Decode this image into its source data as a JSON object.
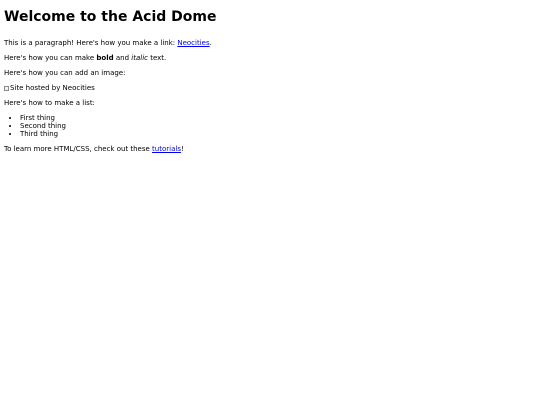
{
  "page": {
    "heading": "Welcome to the Acid Dome",
    "para1": {
      "prefix": "This is a paragraph! Here's how you make a link: ",
      "link": "Neocities",
      "suffix": "."
    },
    "para2": {
      "prefix": "Here's how you can make ",
      "bold": "bold",
      "middle": " and ",
      "italic": "italic",
      "suffix": " text."
    },
    "para3": "Here's how you can add an image:",
    "image_alt": "Site hosted by Neocities",
    "list_intro": "Here's how to make a list:",
    "list_items": [
      "First thing",
      "Second thing",
      "Third thing"
    ],
    "final": {
      "prefix": "To learn more HTML/CSS, check out these ",
      "link": "tutorials",
      "suffix": "!"
    }
  }
}
